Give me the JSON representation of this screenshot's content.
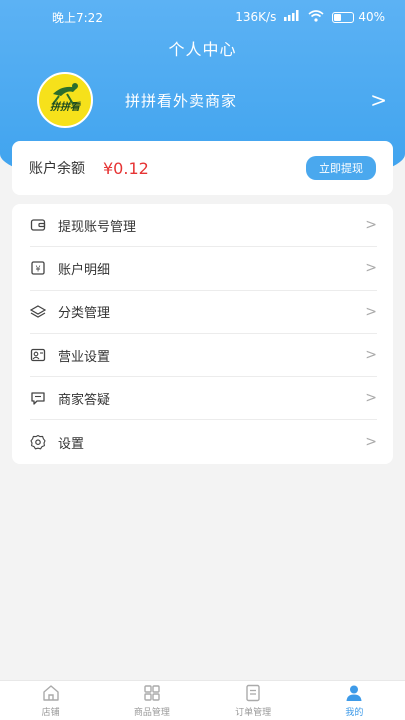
{
  "status_bar": {
    "time": "晚上7:22",
    "network_speed": "136K/s",
    "battery": "40%"
  },
  "header": {
    "title": "个人中心"
  },
  "profile": {
    "avatar_logo_text": "拼拼看",
    "merchant_name": "拼拼看外卖商家",
    "arrow": ">"
  },
  "balance": {
    "label": "账户余额",
    "value": "¥0.12",
    "withdraw_label": "立即提现"
  },
  "menu": {
    "items": [
      {
        "label": "提现账号管理",
        "icon": "wallet-icon"
      },
      {
        "label": "账户明细",
        "icon": "yuan-receipt-icon"
      },
      {
        "label": "分类管理",
        "icon": "layers-icon"
      },
      {
        "label": "营业设置",
        "icon": "id-card-icon"
      },
      {
        "label": "商家答疑",
        "icon": "message-icon"
      },
      {
        "label": "设置",
        "icon": "gear-icon"
      }
    ],
    "arrow": ">"
  },
  "tabbar": {
    "tabs": [
      {
        "label": "店铺",
        "icon": "store-icon"
      },
      {
        "label": "商品管理",
        "icon": "grid-icon"
      },
      {
        "label": "订单管理",
        "icon": "order-icon"
      },
      {
        "label": "我的",
        "icon": "user-icon",
        "active": true
      }
    ]
  },
  "colors": {
    "primary": "#3da2ee",
    "price": "#e63434",
    "active_tab": "#3d9ae8"
  }
}
